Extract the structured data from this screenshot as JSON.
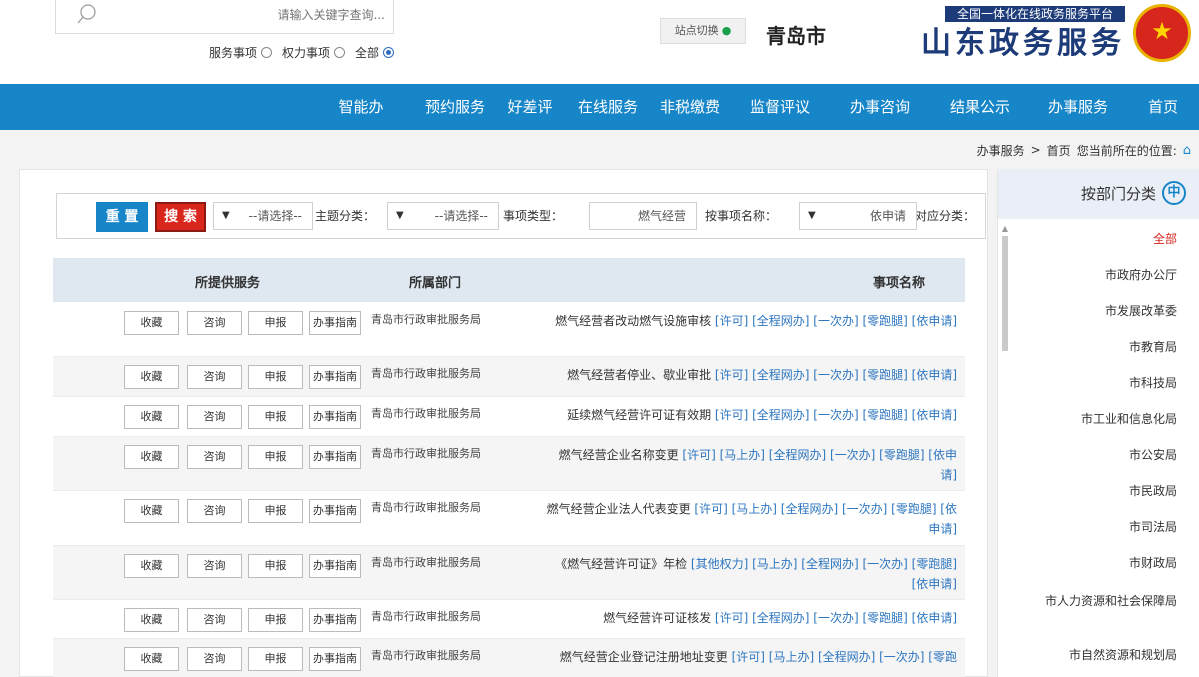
{
  "header": {
    "platform_banner": "全国一体化在线政务服务平台",
    "site_title": "山东政务服务",
    "city": "青岛市",
    "switch_label": "站点切换",
    "search_placeholder": "请输入关键字查询...",
    "search_scope": [
      {
        "label": "全部",
        "checked": true
      },
      {
        "label": "权力事项",
        "checked": false
      },
      {
        "label": "服务事项",
        "checked": false
      }
    ]
  },
  "nav": {
    "items": [
      "首页",
      "办事服务",
      "结果公示",
      "办事咨询",
      "监督评议",
      "非税缴费",
      "在线服务",
      "好差评",
      "预约服务",
      "智能办"
    ]
  },
  "breadcrumb": {
    "prefix": "您当前所在的位置:",
    "path": [
      "首页",
      "办事服务"
    ],
    "separator": ">"
  },
  "filter": {
    "category_label": "对应分类：",
    "category_value": "依申请",
    "item_name_label": "按事项名称：",
    "item_name_value": "燃气经营",
    "item_type_label": "事项类型：",
    "item_type_value": "--请选择--",
    "theme_label": "主题分类：",
    "theme_value": "--请选择--",
    "search_button": "搜 索",
    "reset_button": "重 置"
  },
  "table": {
    "headers": {
      "name": "事项名称",
      "dept": "所属部门",
      "services": "所提供服务"
    },
    "service_buttons": [
      "办事指南",
      "申报",
      "咨询",
      "收藏"
    ],
    "rows": [
      {
        "name": "燃气经营者改动燃气设施审核",
        "tags": "[许可] [全程网办] [一次办] [零跑腿] [依申请]",
        "dept": "青岛市行政审批服务局"
      },
      {
        "name": "燃气经营者停业、歇业审批",
        "tags": "[许可] [全程网办] [一次办] [零跑腿] [依申请]",
        "dept": "青岛市行政审批服务局"
      },
      {
        "name": "延续燃气经营许可证有效期",
        "tags": "[许可] [全程网办] [一次办] [零跑腿] [依申请]",
        "dept": "青岛市行政审批服务局"
      },
      {
        "name": "燃气经营企业名称变更",
        "tags": "[许可] [马上办] [全程网办] [一次办] [零跑腿] [依申请]",
        "dept": "青岛市行政审批服务局"
      },
      {
        "name": "燃气经营企业法人代表变更",
        "tags": "[许可] [马上办] [全程网办] [一次办] [零跑腿] [依申请]",
        "dept": "青岛市行政审批服务局"
      },
      {
        "name": "《燃气经营许可证》年检",
        "tags": "[其他权力] [马上办] [全程网办] [一次办] [零跑腿] [依申请]",
        "dept": "青岛市行政审批服务局"
      },
      {
        "name": "燃气经营许可证核发",
        "tags": "[许可] [全程网办] [一次办] [零跑腿] [依申请]",
        "dept": "青岛市行政审批服务局"
      },
      {
        "name": "燃气经营企业登记注册地址变更",
        "tags": "[许可] [马上办] [全程网办] [一次办] [零跑",
        "dept": "青岛市行政审批服务局"
      }
    ]
  },
  "sidebar": {
    "title": "按部门分类",
    "items": [
      "全部",
      "市政府办公厅",
      "市发展改革委",
      "市教育局",
      "市科技局",
      "市工业和信息化局",
      "市公安局",
      "市民政局",
      "市司法局",
      "市财政局",
      "市人力资源和社会保障局",
      "市自然资源和规划局"
    ],
    "active_index": 0
  }
}
